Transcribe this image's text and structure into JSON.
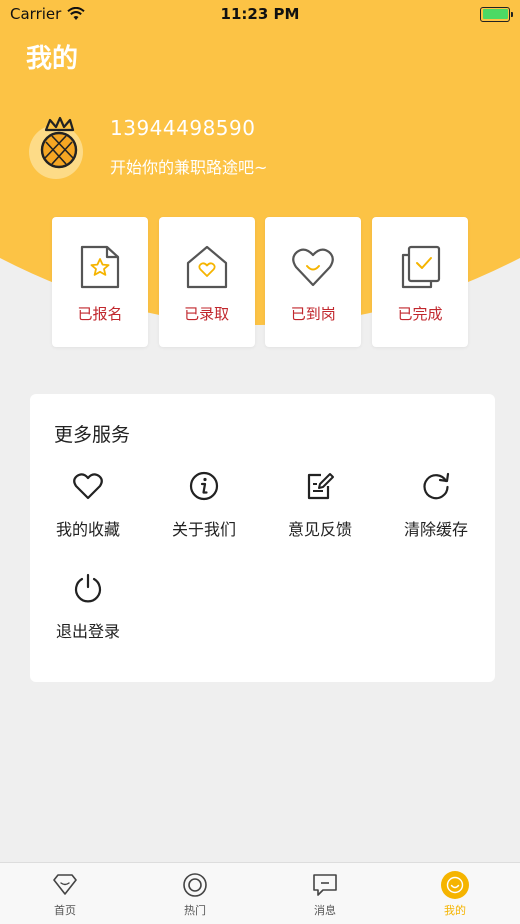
{
  "status_bar": {
    "carrier": "Carrier",
    "time": "11:23 PM"
  },
  "header": {
    "title": "我的"
  },
  "profile": {
    "phone": "13944498590",
    "slogan": "开始你的兼职路途吧~"
  },
  "status_cards": [
    {
      "label": "已报名",
      "icon": "doc-star-icon"
    },
    {
      "label": "已录取",
      "icon": "house-heart-icon"
    },
    {
      "label": "已到岗",
      "icon": "heart-smile-icon"
    },
    {
      "label": "已完成",
      "icon": "doc-check-icon"
    }
  ],
  "services": {
    "title": "更多服务",
    "items": [
      {
        "label": "我的收藏",
        "icon": "heart-icon"
      },
      {
        "label": "关于我们",
        "icon": "info-icon"
      },
      {
        "label": "意见反馈",
        "icon": "feedback-edit-icon"
      },
      {
        "label": "清除缓存",
        "icon": "refresh-icon"
      },
      {
        "label": "退出登录",
        "icon": "power-icon"
      }
    ]
  },
  "tabbar": {
    "tabs": [
      {
        "label": "首页",
        "icon": "home-diamond-icon"
      },
      {
        "label": "热门",
        "icon": "hot-circle-icon"
      },
      {
        "label": "消息",
        "icon": "message-icon"
      },
      {
        "label": "我的",
        "icon": "profile-smile-icon",
        "active": true
      }
    ]
  },
  "colors": {
    "accent": "#fcc345",
    "label_red": "#c1272d",
    "tab_active": "#f5b400"
  }
}
